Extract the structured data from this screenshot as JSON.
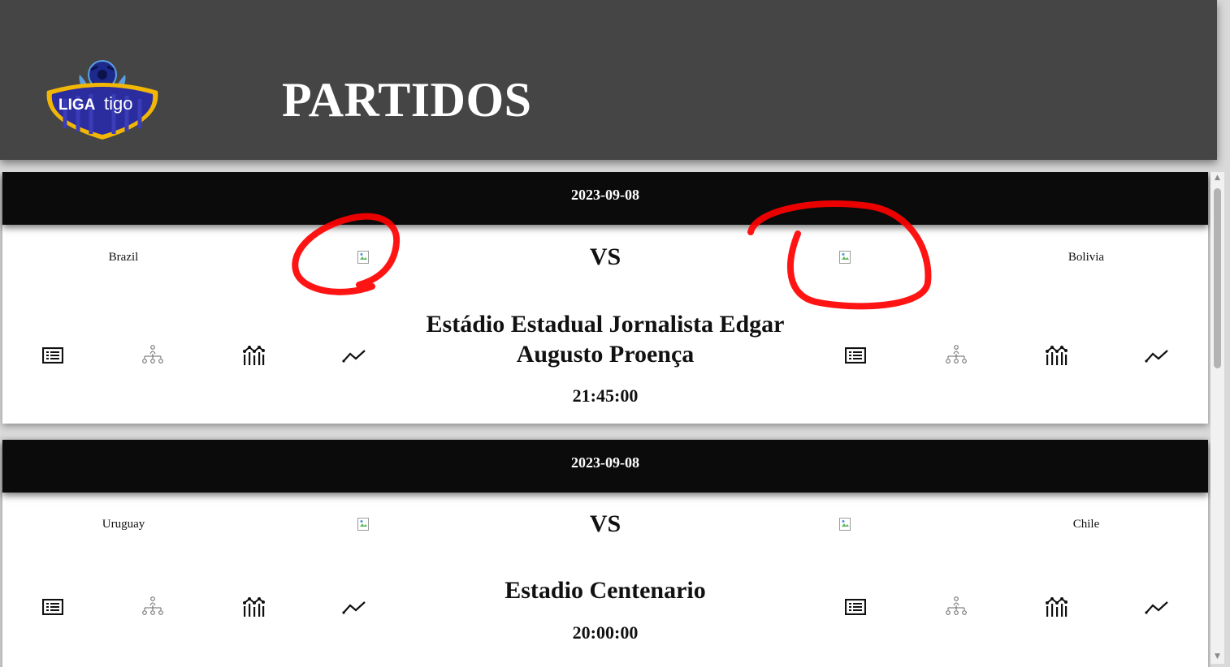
{
  "header": {
    "title": "PARTIDOS",
    "logo_text": "LIGA tigo"
  },
  "matches": [
    {
      "date": "2023-09-08",
      "home_team": "Brazil",
      "away_team": "Bolivia",
      "vs_label": "VS",
      "stadium": "Estádio Estadual Jornalista Edgar Augusto Proença",
      "time": "21:45:00"
    },
    {
      "date": "2023-09-08",
      "home_team": "Uruguay",
      "away_team": "Chile",
      "vs_label": "VS",
      "stadium": "Estadio Centenario",
      "time": "20:00:00"
    }
  ],
  "icons": [
    "list-icon",
    "hierarchy-icon",
    "stats-icon",
    "trend-icon"
  ],
  "colors": {
    "header_bg": "#454545",
    "date_bar_bg": "#0b0b0b",
    "card_bg": "#ffffff",
    "annotation_red": "#ff0000",
    "logo_blue": "#2b2d9e",
    "logo_gold": "#f2b705"
  }
}
